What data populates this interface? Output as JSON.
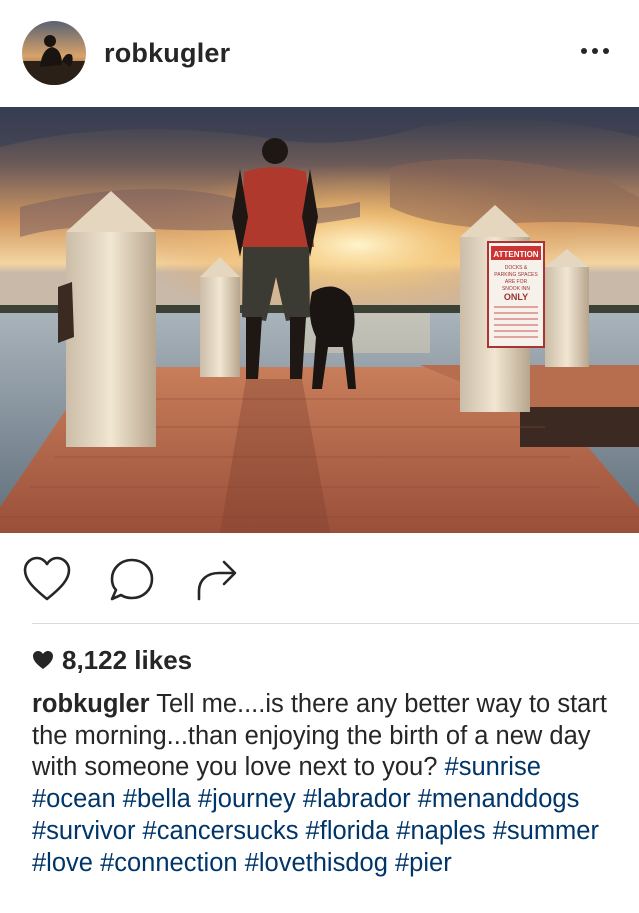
{
  "post": {
    "username": "robkugler",
    "likes": "8,122 likes"
  },
  "caption": {
    "username": "robkugler",
    "text": "Tell me....is there any better way to start the morning...than enjoying the birth of a new day with someone you love next to you?",
    "hashtags": [
      "#sunrise",
      "#ocean",
      "#bella",
      "#journey",
      "#labrador",
      "#menanddogs",
      "#survivor",
      "#cancersucks",
      "#florida",
      "#naples",
      "#summer",
      "#love",
      "#connection",
      "#lovethisdog",
      "#pier"
    ]
  },
  "photo": {
    "sign_lines": [
      "ATTENTION",
      "DOCKS &",
      "PARKING SPACES",
      "ARE FOR",
      "SNOOK INN",
      "ONLY"
    ]
  },
  "icons": {
    "avatar": "profile-photo",
    "more": "more-options-icon",
    "like": "heart-outline-icon",
    "comment": "comment-bubble-icon",
    "share": "share-arrow-icon",
    "likes_heart": "heart-filled-icon"
  },
  "colors": {
    "text": "#262626",
    "hashtag": "#003569",
    "divider": "#dbdbdb",
    "sky_top": "#2f3a4f",
    "sun": "#ffe9a8",
    "dock": "#b96a4d"
  }
}
